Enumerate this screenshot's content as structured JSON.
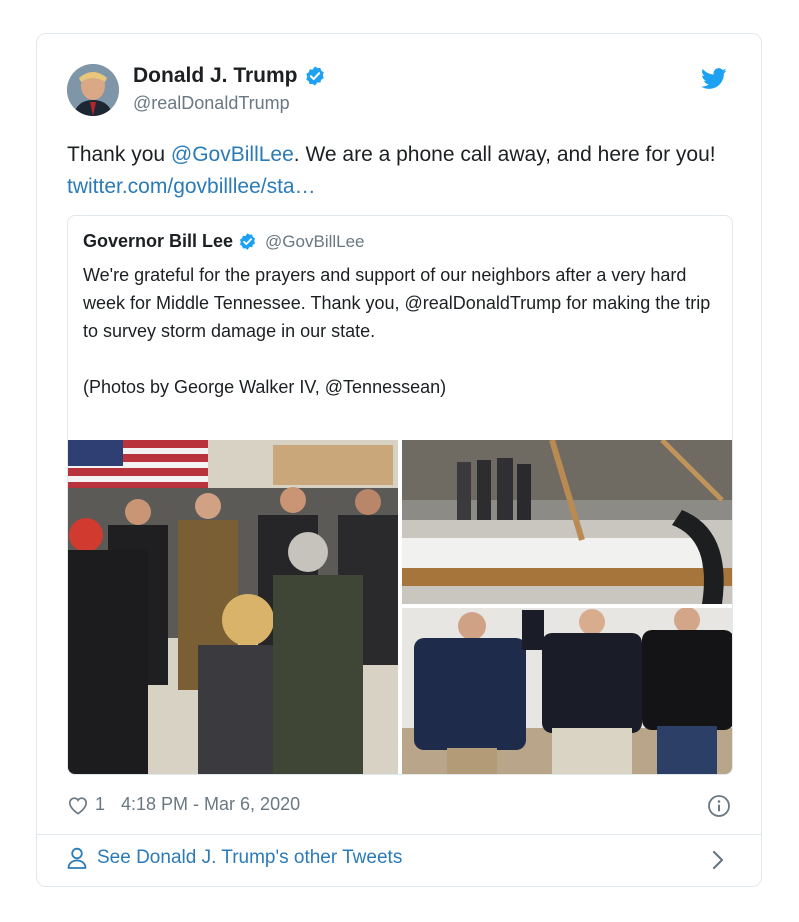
{
  "author": {
    "name": "Donald J. Trump",
    "handle": "@realDonaldTrump",
    "avatar_icon": "avatar-photo",
    "verified_color": "#1da1f2"
  },
  "tweet": {
    "text_prefix": "Thank you ",
    "mention": "@GovBillLee",
    "text_mid": ". We are a phone call away, and here for you! ",
    "link": "twitter.com/govbilllee/sta…"
  },
  "quote": {
    "name": "Governor Bill Lee",
    "handle": "@GovBillLee",
    "paragraph1": "We're grateful for the prayers and support of our neighbors after a very hard week for Middle Tennessee. Thank you, @realDonaldTrump for making the trip to survey storm damage in our state.",
    "paragraph2": "(Photos by George Walker IV, @Tennessean)"
  },
  "meta": {
    "likes": "1",
    "timestamp": "4:18 PM - Mar 6, 2020"
  },
  "footer": {
    "label": "See Donald J. Trump's other Tweets"
  },
  "colors": {
    "link": "#2b7bb9",
    "twitter_blue": "#1da1f2",
    "muted": "#697882",
    "border": "#e1e8ed"
  },
  "icons": [
    "verified-icon",
    "twitter-bird-icon",
    "heart-icon",
    "info-icon",
    "person-icon",
    "chevron-right-icon"
  ]
}
